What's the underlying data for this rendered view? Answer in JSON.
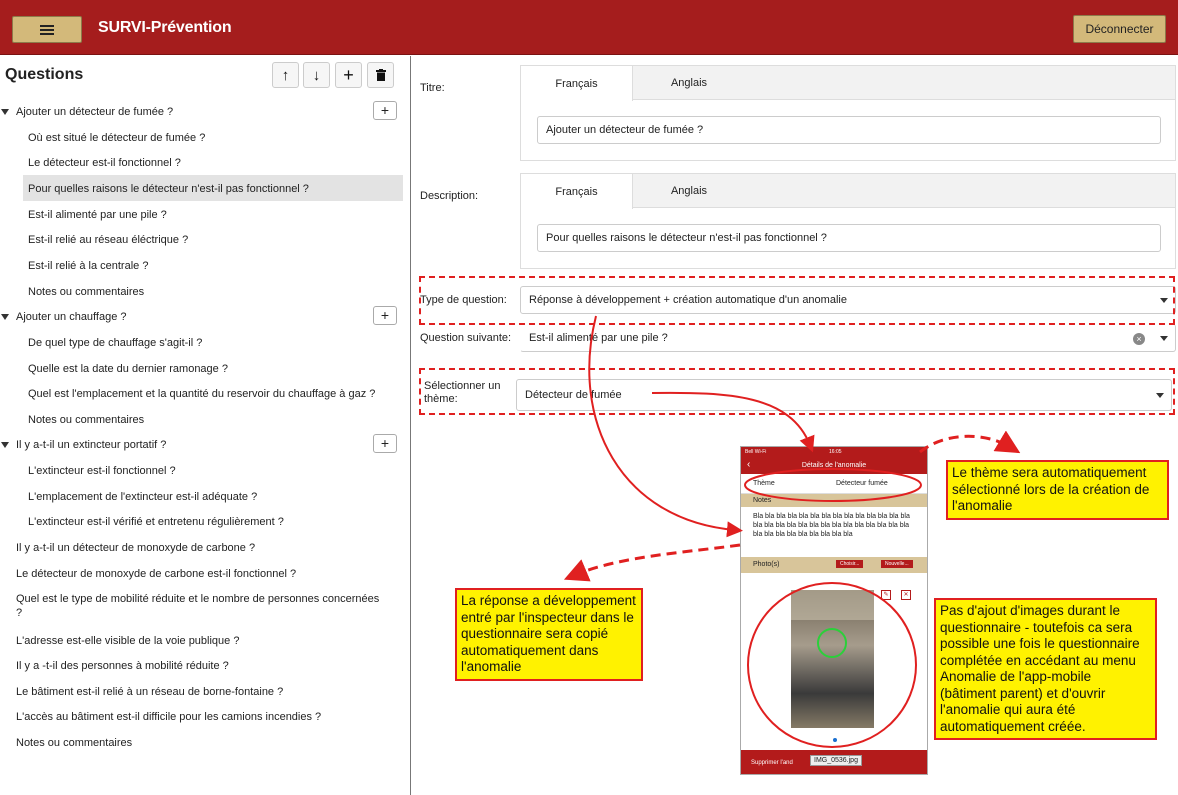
{
  "header": {
    "app_title": "SURVI-Prévention",
    "logout_label": "Déconnecter",
    "brand_color": "#a51d1d",
    "button_color": "#d3b97a"
  },
  "sidebar": {
    "title": "Questions",
    "tools": [
      {
        "icon": "arrow-up-icon",
        "glyph": "↑"
      },
      {
        "icon": "arrow-down-icon",
        "glyph": "↓"
      },
      {
        "icon": "add-icon",
        "glyph": "+"
      },
      {
        "icon": "trash-icon",
        "glyph": "🗑"
      }
    ],
    "groups": [
      {
        "label": "Ajouter un détecteur de fumée ?",
        "children": [
          "Où est situé le détecteur de fumée ?",
          "Le détecteur est-il fonctionnel ?",
          "Pour quelles raisons le détecteur n'est-il pas fonctionnel ?",
          "Est-il alimenté par une pile ?",
          "Est-il relié au réseau éléctrique ?",
          "Est-il relié à la centrale ?",
          "Notes ou commentaires"
        ]
      },
      {
        "label": "Ajouter un chauffage ?",
        "children": [
          "De quel type de chauffage s'agit-il ?",
          "Quelle est la date du dernier ramonage ?",
          "Quel est l'emplacement et la quantité du reservoir du chauffage à gaz ?",
          "Notes ou commentaires"
        ]
      },
      {
        "label": "Il y a-t-il un extincteur portatif ?",
        "children": [
          "L'extincteur est-il fonctionnel ?",
          "L'emplacement de l'extincteur est-il adéquate ?",
          "L'extincteur est-il vérifié et entretenu régulièrement ?"
        ]
      }
    ],
    "top_level": [
      "Il y a-t-il un détecteur de monoxyde de carbone ?",
      "Le détecteur de monoxyde de carbone est-il fonctionnel ?",
      "Quel est le type de mobilité réduite et le nombre de personnes concernées",
      "?",
      "L'adresse est-elle visible de la voie publique ?",
      "Il y a -t-il des personnes à mobilité réduite ?",
      "Le bâtiment est-il relié à un réseau de borne-fontaine ?",
      "L'accès au bâtiment est-il difficile pour les camions incendies ?",
      "Notes ou commentaires"
    ],
    "selected_item": "Pour quelles raisons le détecteur n'est-il pas fonctionnel ?"
  },
  "form": {
    "title_label": "Titre:",
    "description_label": "Description:",
    "tab_fr": "Français",
    "tab_en": "Anglais",
    "title_value": "Ajouter un détecteur de fumée ?",
    "description_value": "Pour quelles raisons le détecteur n'est-il pas fonctionnel ?",
    "type_label": "Type de question:",
    "type_value": "Réponse à développement + création automatique d'un anomalie",
    "next_label": "Question suivante:",
    "next_value": "Est-il alimenté par une pile ?",
    "theme_label_1": "Sélectionner un",
    "theme_label_2": "thème:",
    "theme_value": "Détecteur de fumée"
  },
  "annotations": {
    "note_theme": "Le thème sera automatiquement sélectionné lors de la création de l'anomalie",
    "note_answer": "La réponse a développement entré par l'inspecteur dans le questionnaire sera copié automatiquement dans l'anomalie",
    "note_images": "Pas d'ajout d'images durant le questionnaire - toutefois ca sera possible une fois le questionnaire complétée en accédant au menu Anomalie de l'app-mobile (bâtiment parent) et d'ouvrir l'anomalie qui aura été automatiquement créée.",
    "accent_color": "#e02020",
    "note_color": "#fff200"
  },
  "phone": {
    "carrier": "Bell Wi-Fi",
    "time": "16:05",
    "nav_title": "Détails de l'anomalie",
    "theme_label": "Thème",
    "theme_value": "Détecteur fumée",
    "notes_label": "Notes",
    "notes_text": "Bla bla bla bla bla bla bla bla bla bla bla bla bla bla bla bla bla bla bla bla bla bla bla bla bla bla bla bla bla bla bla bla bla bla bla bla bla",
    "photos_label": "Photo(s)",
    "choose_label": "Choisir...",
    "new_label": "Nouvelle...",
    "delete_label": "Supprimer l'and",
    "image_name": "IMG_0536.jpg"
  }
}
